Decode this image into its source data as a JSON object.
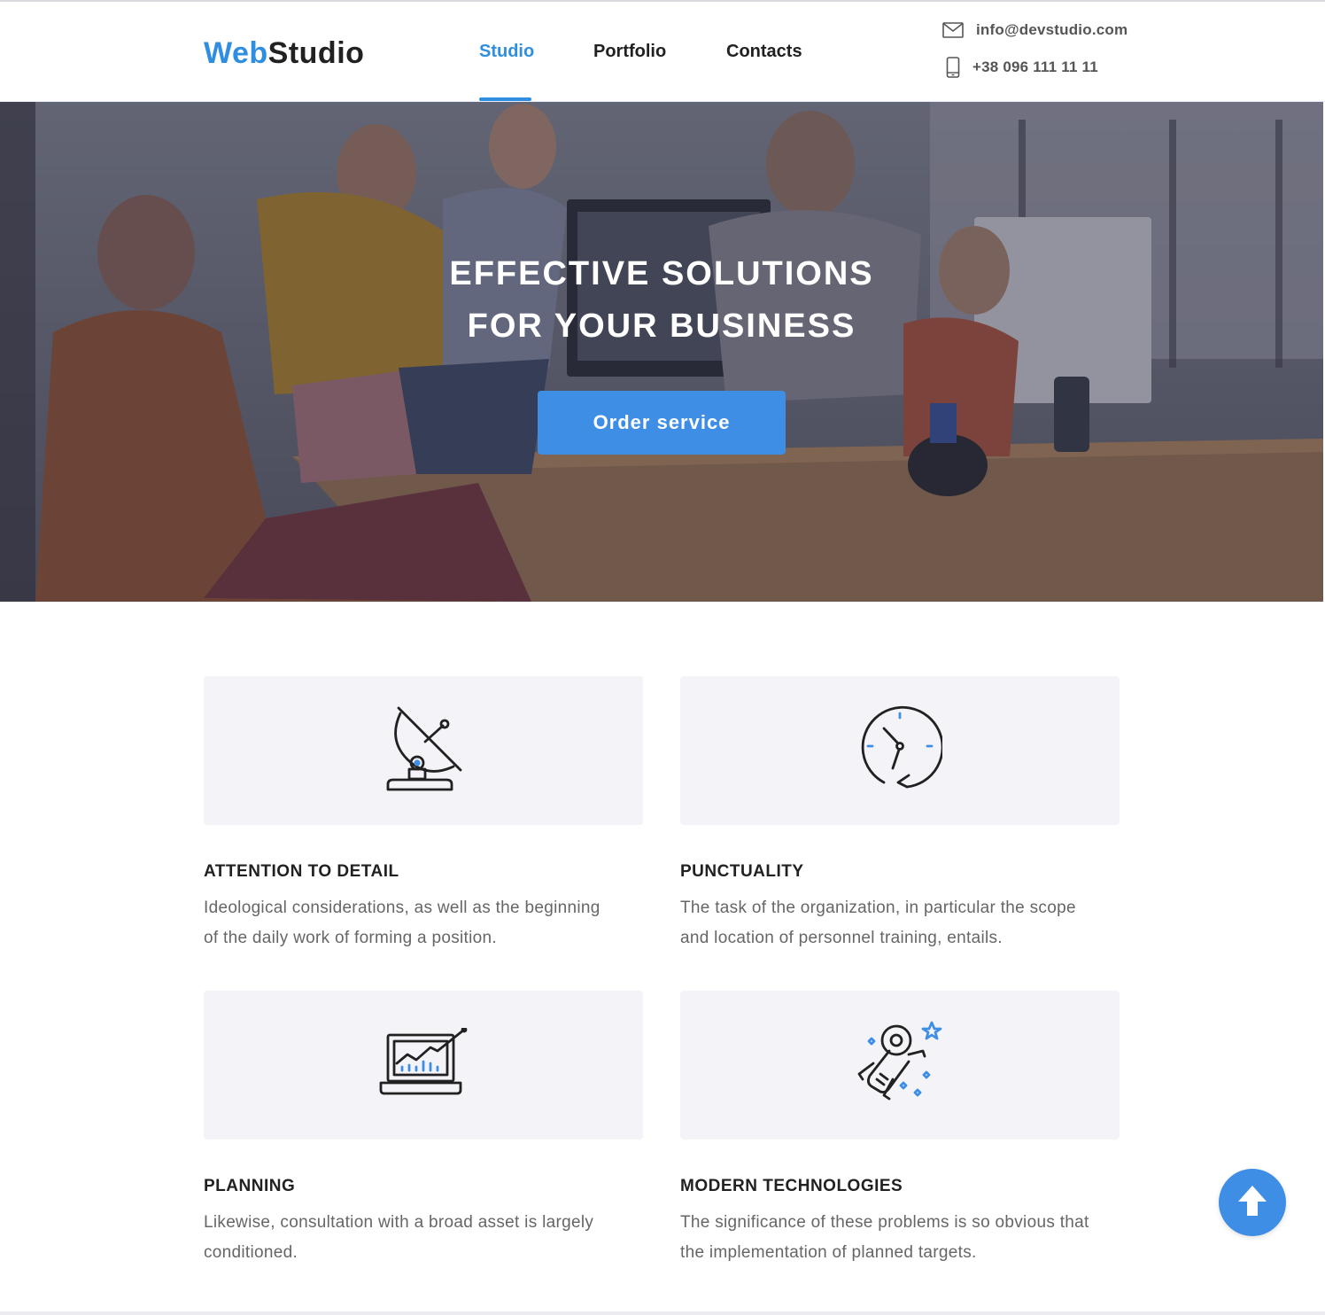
{
  "logo": {
    "part1": "Web",
    "part2": "Studio"
  },
  "nav": {
    "items": [
      "Studio",
      "Portfolio",
      "Contacts"
    ],
    "active": "Studio"
  },
  "contacts": {
    "email": "info@devstudio.com",
    "phone": "+38 096 111 11 11",
    "email_icon": "envelope-icon",
    "phone_icon": "smartphone-icon"
  },
  "hero": {
    "title_line1": "EFFECTIVE SOLUTIONS",
    "title_line2": "FOR YOUR BUSINESS",
    "button": "Order service"
  },
  "features": [
    {
      "icon": "satellite-dish-icon",
      "title": "ATTENTION TO DETAIL",
      "desc_line1": "Ideological considerations, as well as the beginning",
      "desc_line2": "of the daily work of forming a position."
    },
    {
      "icon": "clock-icon",
      "title": "PUNCTUALITY",
      "desc_line1": "The task of the organization, in particular the scope",
      "desc_line2": "and location of personnel training, entails."
    },
    {
      "icon": "laptop-chart-icon",
      "title": "PLANNING",
      "desc_line1": "Likewise, consultation with a broad asset is largely",
      "desc_line2": "conditioned."
    },
    {
      "icon": "astronaut-icon",
      "title": "MODERN TECHNOLOGIES",
      "desc_line1": "The significance of these problems is so obvious that",
      "desc_line2": "the implementation of planned targets."
    }
  ],
  "scroll_top_icon": "arrow-up-icon",
  "colors": {
    "accent": "#2f8ee0",
    "button": "#3f8ee6",
    "card_bg": "#f3f3f8",
    "text": "#212121",
    "muted": "#666666"
  }
}
